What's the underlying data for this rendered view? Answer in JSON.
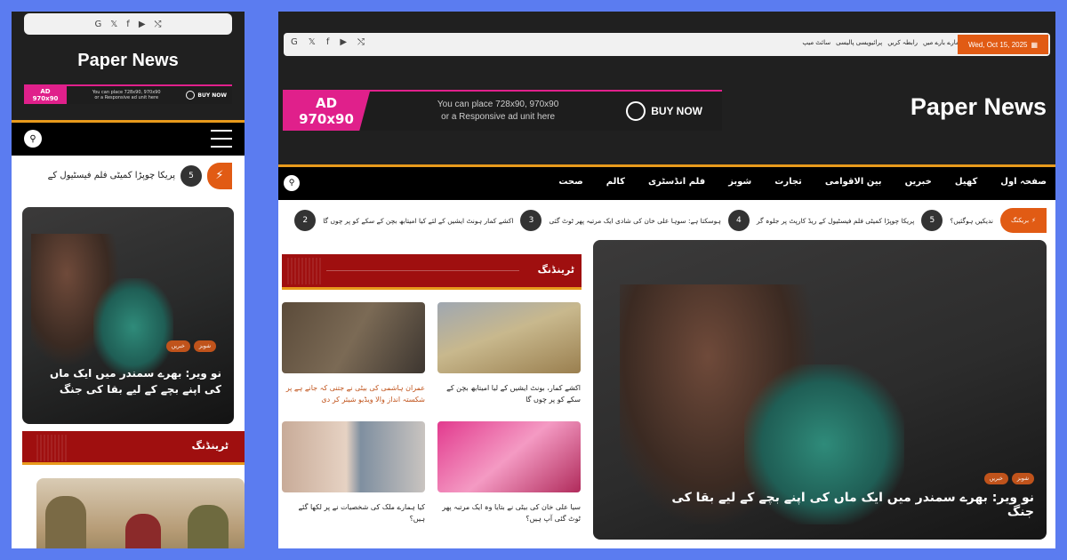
{
  "site": {
    "name": "Paper News",
    "date": "Wed, Oct 15, 2025"
  },
  "social": [
    "G",
    "𝕏",
    "f",
    "▶",
    "⤭"
  ],
  "top_links": [
    "ہمارے بارے میں",
    "رابطہ کریں",
    "پرائیویسی پالیسی",
    "سائٹ میپ"
  ],
  "ad": {
    "badge_top": "AD",
    "badge_bottom": "970x90",
    "text_line1": "You can place 728x90, 970x90",
    "text_line2": "or a Responsive ad unit here",
    "buy": "BUY NOW"
  },
  "nav": {
    "items": [
      "صفحہ اول",
      "کھیل",
      "خبریں",
      "بین الاقوامی",
      "تجارت",
      "شوبز",
      "فلم انڈسٹری",
      "کالم",
      "صحت"
    ]
  },
  "breaking": {
    "label": "بریکنگ",
    "items": [
      {
        "num": "5",
        "text": "ندیکیں ہوگئیں؟"
      },
      {
        "num": "4",
        "text": "پریکا چوپڑا کمیٹی فلم فیسٹیول کے ریڈ کارپٹ پر جلوہ گر"
      },
      {
        "num": "3",
        "text": "ہوسکتا ہے: سوہا علی خان کی شادی ایک مرتبہ پھر ٹوٹ گئی"
      },
      {
        "num": "2",
        "text": "اکشے کمار ہونٹ ایشیں کے لئے کیا امیتابھ بچن کے سکے کو پر چوں گا"
      }
    ]
  },
  "mobile_ticker": {
    "num": "5",
    "text": "پریکا چوپڑا کمیٹی فلم فیسٹیول کے"
  },
  "hero": {
    "tags": [
      "شوبز",
      "خبریں"
    ],
    "title": "نو ویر: بھرے سمندر میں ایک ماں کی اپنے بچے کے لیے بقا کی جنگ",
    "mobile_title": "نو ویر: بھرے سمندر میں ایک ماں کی اپنے بچے کے لیے بقا کی جنگ"
  },
  "trending": {
    "label": "ٹرینڈنگ",
    "cards": [
      {
        "caption": "اکشے کمار، بونٹ ایشیں کے لیا امیتابھ بچن کے سکے کو پر چوں گا"
      },
      {
        "caption": "عمران ہاشمی کی بیٹی نے جتنی کہ جانے ہے پر شکستہ انداز والا ویڈیو شیئر کر دی"
      },
      {
        "caption": "سیا علی خان کی بیٹی نے بتایا وہ ایک مرتبہ پھر ٹوٹ گئی آپ ہیں؟"
      },
      {
        "caption": "کیا ہمارے ملک کی شخصیات نے پر لکھا گئے ہیں؟"
      }
    ]
  }
}
